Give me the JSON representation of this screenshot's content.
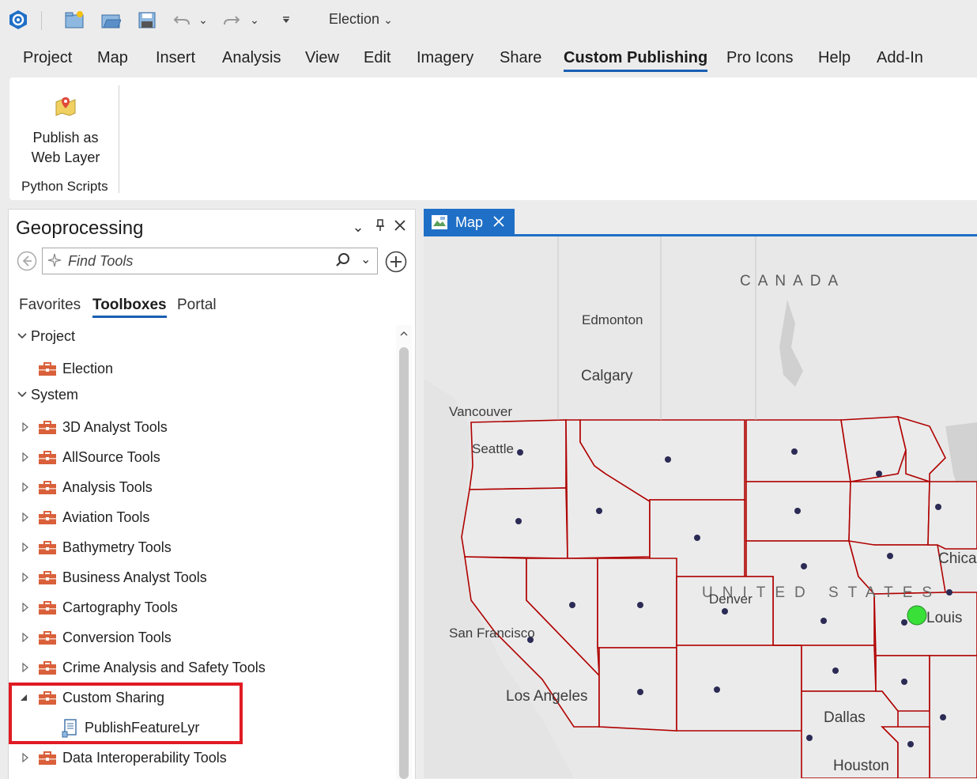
{
  "quick_access": {
    "project_name": "Election",
    "icons": [
      "app-icon",
      "new-project-icon",
      "open-project-icon",
      "save-project-icon",
      "undo-icon",
      "redo-icon",
      "customize-icon"
    ]
  },
  "ribbon": {
    "tabs": [
      "Project",
      "Map",
      "Insert",
      "Analysis",
      "View",
      "Edit",
      "Imagery",
      "Share",
      "Custom Publishing",
      "Pro Icons",
      "Help",
      "Add-In"
    ],
    "active_tab": "Custom Publishing",
    "button_label_1": "Publish as",
    "button_label_2": "Web Layer",
    "group_label": "Python Scripts"
  },
  "geoprocessing": {
    "title": "Geoprocessing",
    "search_placeholder": "Find Tools",
    "subtabs": [
      "Favorites",
      "Toolboxes",
      "Portal"
    ],
    "active_subtab": "Toolboxes",
    "tree": [
      {
        "label": "Project",
        "level": 0,
        "expanded": true,
        "type": "group"
      },
      {
        "label": "Election",
        "level": 1,
        "type": "toolbox"
      },
      {
        "label": "System",
        "level": 0,
        "expanded": true,
        "type": "group"
      },
      {
        "label": "3D Analyst Tools",
        "level": 1,
        "type": "toolbox"
      },
      {
        "label": "AllSource Tools",
        "level": 1,
        "type": "toolbox"
      },
      {
        "label": "Analysis Tools",
        "level": 1,
        "type": "toolbox"
      },
      {
        "label": "Aviation Tools",
        "level": 1,
        "type": "toolbox"
      },
      {
        "label": "Bathymetry Tools",
        "level": 1,
        "type": "toolbox"
      },
      {
        "label": "Business Analyst Tools",
        "level": 1,
        "type": "toolbox"
      },
      {
        "label": "Cartography Tools",
        "level": 1,
        "type": "toolbox"
      },
      {
        "label": "Conversion Tools",
        "level": 1,
        "type": "toolbox"
      },
      {
        "label": "Crime Analysis and Safety Tools",
        "level": 1,
        "type": "toolbox"
      },
      {
        "label": "Custom Sharing",
        "level": 1,
        "type": "toolbox",
        "expanded": true
      },
      {
        "label": "PublishFeatureLyr",
        "level": 2,
        "type": "script"
      },
      {
        "label": "Data Interoperability Tools",
        "level": 1,
        "type": "toolbox"
      }
    ]
  },
  "map": {
    "tab_label": "Map",
    "labels": [
      "CANADA",
      "Edmonton",
      "Calgary",
      "Vancouver",
      "Seattle",
      "San Francisco",
      "Los Angeles",
      "Denver",
      "Dallas",
      "Houston",
      "Chica",
      "Louis",
      "UNITED STATES"
    ]
  },
  "colors": {
    "accent": "#1f6fc6",
    "border_state": "#b00000",
    "highlight": "#e01b24",
    "toolbox": "#d9603a"
  }
}
